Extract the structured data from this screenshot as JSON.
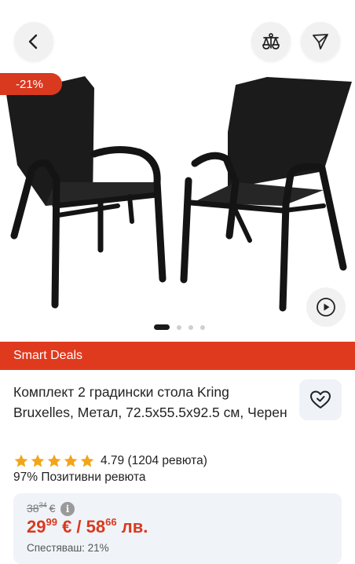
{
  "gallery": {
    "discount_badge": "-21%",
    "active_dot": 1,
    "dot_count": 4
  },
  "icons": {
    "back": "chevron-left-icon",
    "compare": "scale-icon",
    "share": "send-icon",
    "play": "play-icon",
    "favorite": "heart-icon",
    "star": "star-icon",
    "info": "info-icon"
  },
  "deal_bar": {
    "label": "Smart Deals"
  },
  "product": {
    "title": "Комплект 2 градински стола Kring Bruxelles, Метал, 72.5x55.5x92.5 см, Черен"
  },
  "rating": {
    "stars": 5,
    "value_text": "4.79 (1204 ревюта)",
    "positive_text": "97% Позитивни ревюта"
  },
  "price": {
    "old_whole": "38",
    "old_cents": "34",
    "old_currency": "€",
    "info_glyph": "i",
    "eur_whole": "29",
    "eur_cents": "99",
    "eur_currency": "€ /",
    "bgn_whole": "58",
    "bgn_cents": "66",
    "bgn_currency": "лв.",
    "savings_text": "Спестяваш: 21%"
  },
  "colors": {
    "accent": "#e03a1e",
    "price_red": "#d9391f",
    "star": "#f2a51b",
    "card_bg": "#f0f3f7"
  }
}
